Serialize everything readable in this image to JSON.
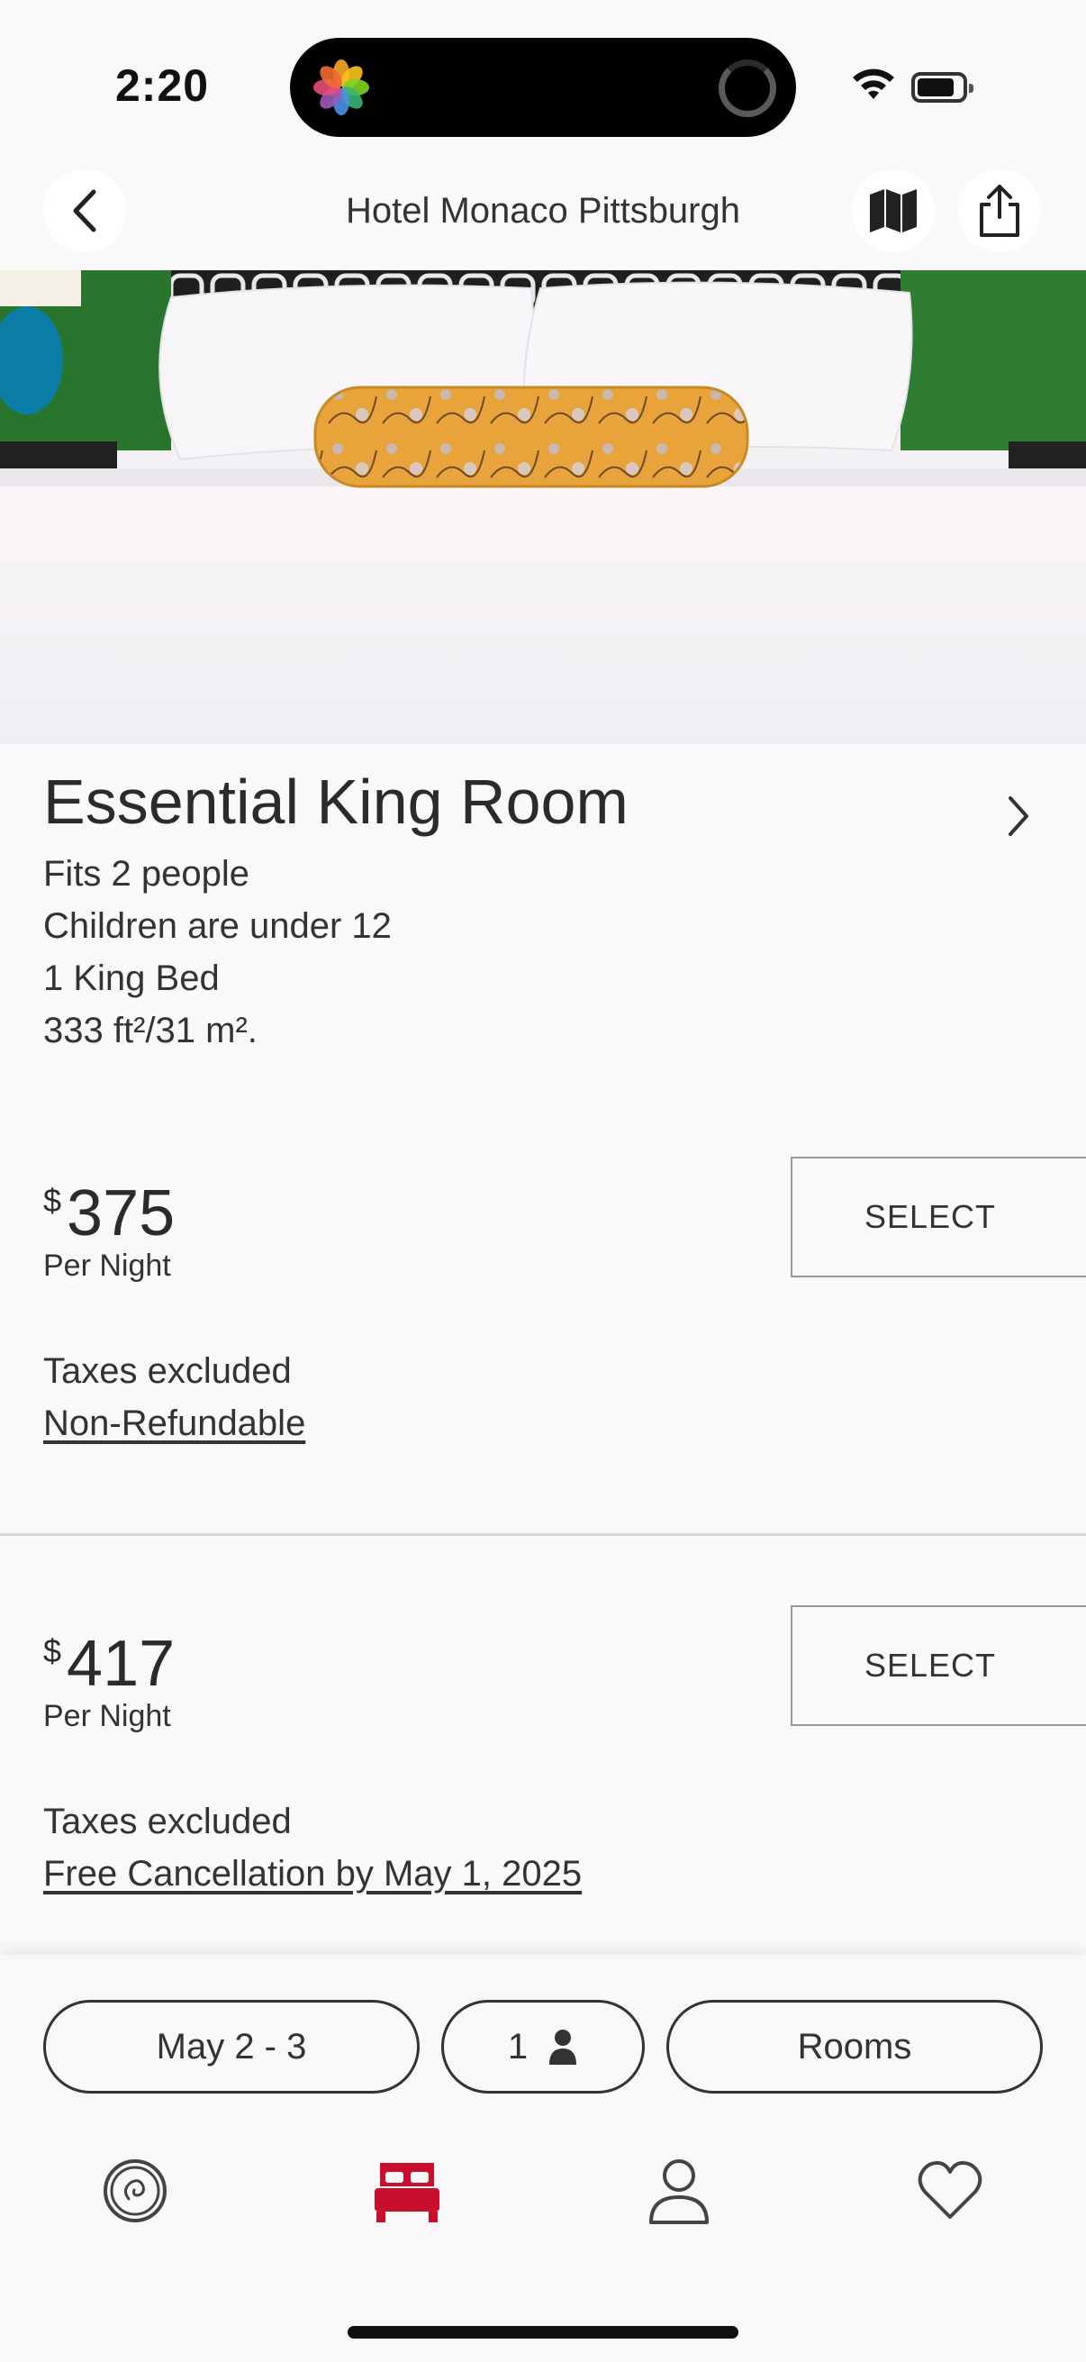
{
  "status": {
    "time": "2:20"
  },
  "header": {
    "title": "Hotel Monaco Pittsburgh"
  },
  "room": {
    "title": "Essential King Room",
    "details": [
      "Fits 2 people",
      "Children are under 12",
      "1 King Bed",
      "333 ft²/31 m²."
    ]
  },
  "rates": [
    {
      "currency": "$",
      "price": "375",
      "per_night": "Per Night",
      "select_label": "SELECT",
      "taxes": "Taxes excluded",
      "policy": "Non-Refundable"
    },
    {
      "currency": "$",
      "price": "417",
      "per_night": "Per Night",
      "select_label": "SELECT",
      "taxes": "Taxes excluded",
      "policy": "Free Cancellation by May 1, 2025"
    }
  ],
  "search": {
    "dates": "May 2 - 3",
    "guests": "1",
    "rooms": "Rooms"
  },
  "tabbar": {
    "items": [
      {
        "icon": "home-swirl-icon"
      },
      {
        "icon": "bed-icon",
        "active": true
      },
      {
        "icon": "person-icon"
      },
      {
        "icon": "heart-icon"
      }
    ]
  },
  "colors": {
    "accent": "#c8102e",
    "text": "#2b2b2b",
    "background": "#f9f9f9"
  }
}
